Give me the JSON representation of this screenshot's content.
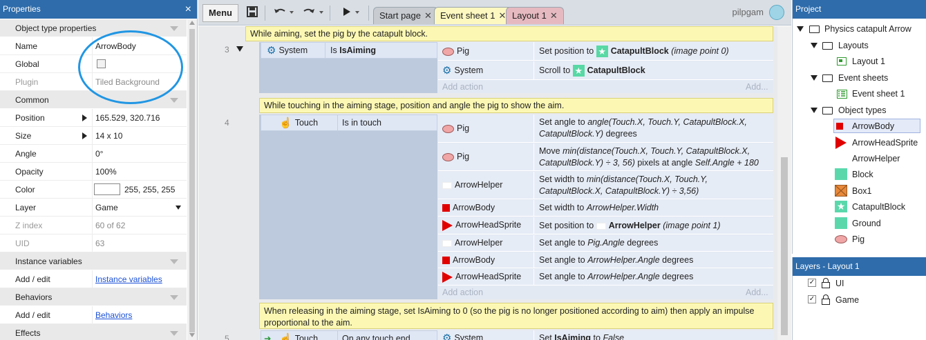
{
  "properties": {
    "title": "Properties",
    "close_icon": "×",
    "sections": {
      "object_type": "Object type properties",
      "common": "Common",
      "instance_variables": "Instance variables",
      "behaviors": "Behaviors",
      "effects": "Effects"
    },
    "rows": {
      "name": {
        "label": "Name",
        "value": "ArrowBody"
      },
      "global": {
        "label": "Global"
      },
      "plugin": {
        "label": "Plugin",
        "value": "Tiled Background"
      },
      "position": {
        "label": "Position",
        "value": "165.529, 320.716"
      },
      "size": {
        "label": "Size",
        "value": "14 x 10"
      },
      "angle": {
        "label": "Angle",
        "value": "0°"
      },
      "opacity": {
        "label": "Opacity",
        "value": "100%"
      },
      "color": {
        "label": "Color",
        "value": "255, 255, 255"
      },
      "layer": {
        "label": "Layer",
        "value": "Game"
      },
      "zindex": {
        "label": "Z index",
        "value": "60 of 62"
      },
      "uid": {
        "label": "UID",
        "value": "63"
      },
      "inst_vars": {
        "label": "Add / edit",
        "value": "Instance variables"
      },
      "behaviors": {
        "label": "Add / edit",
        "value": "Behaviors"
      }
    }
  },
  "toolbar": {
    "menu_label": "Menu",
    "tabs": {
      "start_page": "Start page",
      "event_sheet": "Event sheet 1",
      "layout": "Layout 1"
    },
    "close_glyph": "✕",
    "user": "pilpgam"
  },
  "events": {
    "comment1": "While aiming, set the pig by the catapult block.",
    "comment2": "While touching in the aiming stage, position and angle the pig to show the aim.",
    "comment3": "When releasing in the aiming stage, set IsAiming to 0 (so the pig is no longer positioned according to aim) then apply an impulse proportional to the aim.",
    "ev3": {
      "num": "3",
      "cond_obj": "System",
      "cond_text_pre": "Is",
      "cond_text_bold": "IsAiming",
      "a1_obj": "Pig",
      "a1_pre": "Set position to",
      "a1_bold": "CatapultBlock",
      "a1_italic": "(image point 0)",
      "a2_obj": "System",
      "a2_pre": "Scroll to",
      "a2_bold": "CatapultBlock",
      "add_action": "Add action",
      "add_dim": "Add..."
    },
    "ev4": {
      "num": "4",
      "cond_obj": "Touch",
      "cond_text": "Is in touch",
      "a1_obj": "Pig",
      "a1_pre": "Set angle to",
      "a1_italic": "angle(Touch.X, Touch.Y, CatapultBlock.X, CatapultBlock.Y)",
      "a1_post": "degrees",
      "a2_obj": "Pig",
      "a2_pre": "Move",
      "a2_italic": "min(distance(Touch.X, Touch.Y, CatapultBlock.X, CatapultBlock.Y) ÷ 3, 56)",
      "a2_mid": "pixels at angle",
      "a2_italic2": "Self.Angle + 180",
      "a3_obj": "ArrowHelper",
      "a3_pre": "Set width to",
      "a3_italic": "min(distance(Touch.X, Touch.Y, CatapultBlock.X, CatapultBlock.Y) ÷ 3,56)",
      "a4_obj": "ArrowBody",
      "a4_pre": "Set width to",
      "a4_italic": "ArrowHelper.Width",
      "a5_obj": "ArrowHeadSprite",
      "a5_pre": "Set position to",
      "a5_bold": "ArrowHelper",
      "a5_italic": "(image point 1)",
      "a6_obj": "ArrowHelper",
      "a6_pre": "Set angle to",
      "a6_italic": "Pig.Angle",
      "a6_post": "degrees",
      "a7_obj": "ArrowBody",
      "a7_pre": "Set angle to",
      "a7_italic": "ArrowHelper.Angle",
      "a7_post": "degrees",
      "a8_obj": "ArrowHeadSprite",
      "a8_pre": "Set angle to",
      "a8_italic": "ArrowHelper.Angle",
      "a8_post": "degrees",
      "add_action": "Add action",
      "add_dim": "Add..."
    },
    "ev5": {
      "num": "5",
      "cond_obj": "Touch",
      "cond_text": "On any touch end",
      "a1_obj": "System",
      "a1_pre": "Set",
      "a1_bold": "IsAiming",
      "a1_post": "to",
      "a1_italic": "False"
    }
  },
  "project": {
    "title": "Project",
    "root": "Physics catapult Arrow",
    "layouts_folder": "Layouts",
    "layout1": "Layout 1",
    "eventsheets_folder": "Event sheets",
    "eventsheet1": "Event sheet 1",
    "objecttypes_folder": "Object types",
    "objects": [
      "ArrowBody",
      "ArrowHeadSprite",
      "ArrowHelper",
      "Block",
      "Box1",
      "CatapultBlock",
      "Ground",
      "Pig"
    ]
  },
  "layers": {
    "title": "Layers - Layout 1",
    "items": [
      "UI",
      "Game"
    ],
    "check": "✓"
  },
  "colors": {
    "accent": "#2e6cab",
    "annotation_circle": "#2196e3",
    "comment_bg": "#fcf8b4"
  }
}
